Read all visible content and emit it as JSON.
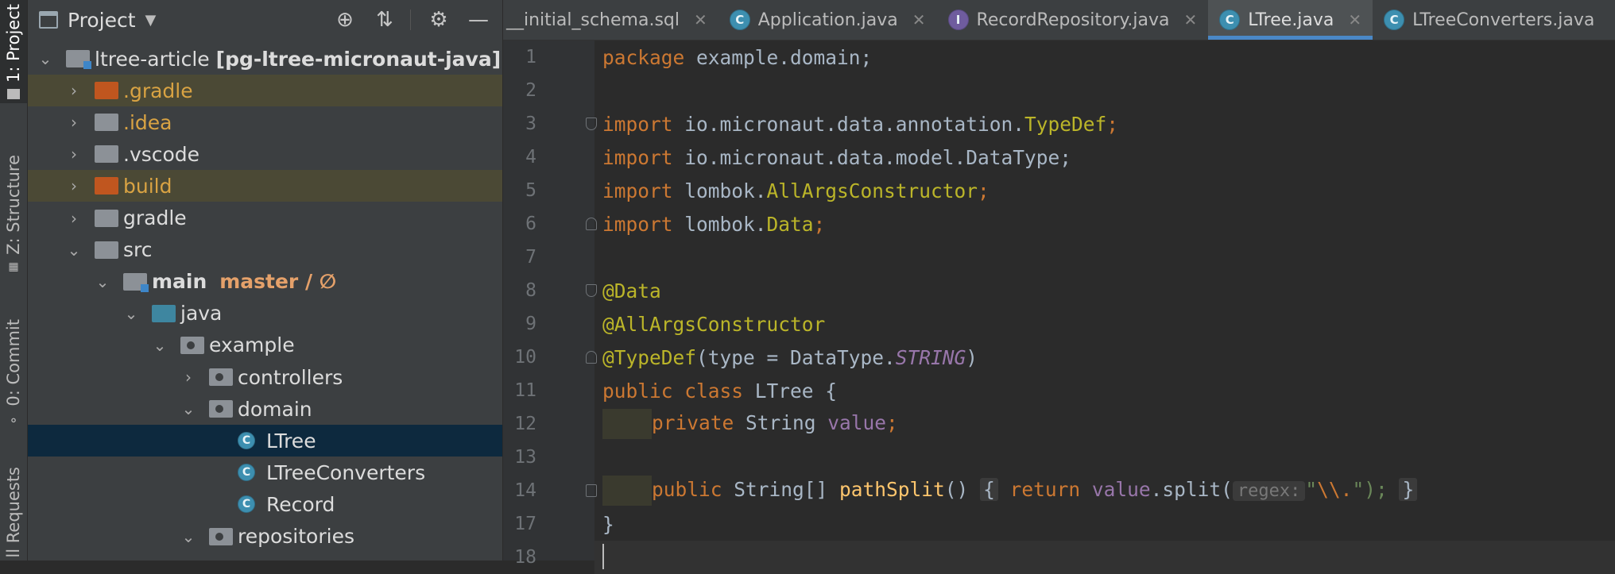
{
  "sidebar_strip": {
    "tabs": [
      {
        "label": "1: Project",
        "icon": "folder-icon"
      },
      {
        "label": "Z: Structure",
        "icon": "structure-icon"
      },
      {
        "label": "0: Commit",
        "icon": "commit-icon"
      },
      {
        "label": "ll Requests",
        "icon": "pull-requests-icon"
      }
    ]
  },
  "project_panel": {
    "title": "Project",
    "toolbar": [
      "crosshair-icon",
      "collapse-icon",
      "gear-icon",
      "minimize-icon"
    ],
    "tree": [
      {
        "label": "ltree-article",
        "extra": "[pg-ltree-micronaut-java]",
        "icon": "module-folder"
      },
      {
        "label": ".gradle",
        "icon": "excluded-folder"
      },
      {
        "label": ".idea",
        "icon": "folder"
      },
      {
        "label": ".vscode",
        "icon": "folder"
      },
      {
        "label": "build",
        "icon": "excluded-folder"
      },
      {
        "label": "gradle",
        "icon": "folder"
      },
      {
        "label": "src",
        "icon": "folder"
      },
      {
        "label": "main",
        "branch": "master / ∅",
        "icon": "source-root-folder"
      },
      {
        "label": "java",
        "icon": "source-folder"
      },
      {
        "label": "example",
        "icon": "package"
      },
      {
        "label": "controllers",
        "icon": "package"
      },
      {
        "label": "domain",
        "icon": "package"
      },
      {
        "label": "LTree",
        "icon": "class"
      },
      {
        "label": "LTreeConverters",
        "icon": "class"
      },
      {
        "label": "Record",
        "icon": "class"
      },
      {
        "label": "repositories",
        "icon": "package"
      }
    ]
  },
  "tabs": [
    {
      "label": "__initial_schema.sql",
      "active": false
    },
    {
      "label": "Application.java",
      "active": false
    },
    {
      "label": "RecordRepository.java",
      "active": false
    },
    {
      "label": "LTree.java",
      "active": true
    },
    {
      "label": "LTreeConverters.java",
      "active": false
    }
  ],
  "editor": {
    "line_numbers": [
      "1",
      "2",
      "3",
      "4",
      "5",
      "6",
      "7",
      "8",
      "9",
      "10",
      "11",
      "12",
      "13",
      "14",
      "17",
      "18"
    ],
    "lines": [
      {
        "t1": "package",
        "t2": " example.domain;"
      },
      {},
      {
        "t1": "import",
        "t2": " io.micronaut.data.annotation.",
        "t3": "TypeDef",
        "t4": ";"
      },
      {
        "t1": "import",
        "t2": " io.micronaut.data.model.DataType;"
      },
      {
        "t1": "import",
        "t2": " lombok.",
        "t3": "AllArgsConstructor",
        "t4": ";"
      },
      {
        "t1": "import",
        "t2": " lombok.",
        "t3": "Data",
        "t4": ";"
      },
      {},
      {
        "t1": "@Data"
      },
      {
        "t1": "@AllArgsConstructor"
      },
      {
        "t1": "@TypeDef",
        "t2": "(type = DataType.",
        "t3": "STRING",
        "t4": ")"
      },
      {
        "t1": "public class",
        "t2": " LTree {"
      },
      {
        "t1": "private",
        "t2": " String ",
        "t3": "value",
        "t4": ";"
      },
      {},
      {
        "t1": "public",
        "t2": " String[] ",
        "t3": "pathSplit",
        "t4": "()",
        "t5": "{",
        "t6": "return",
        "t7": "value",
        "t8": ".split(",
        "hint": "regex:",
        "t9": "\"",
        "t10": "\\\\.",
        "t11": "\");",
        "t12": "}"
      },
      {
        "t1": "}"
      },
      {}
    ]
  }
}
